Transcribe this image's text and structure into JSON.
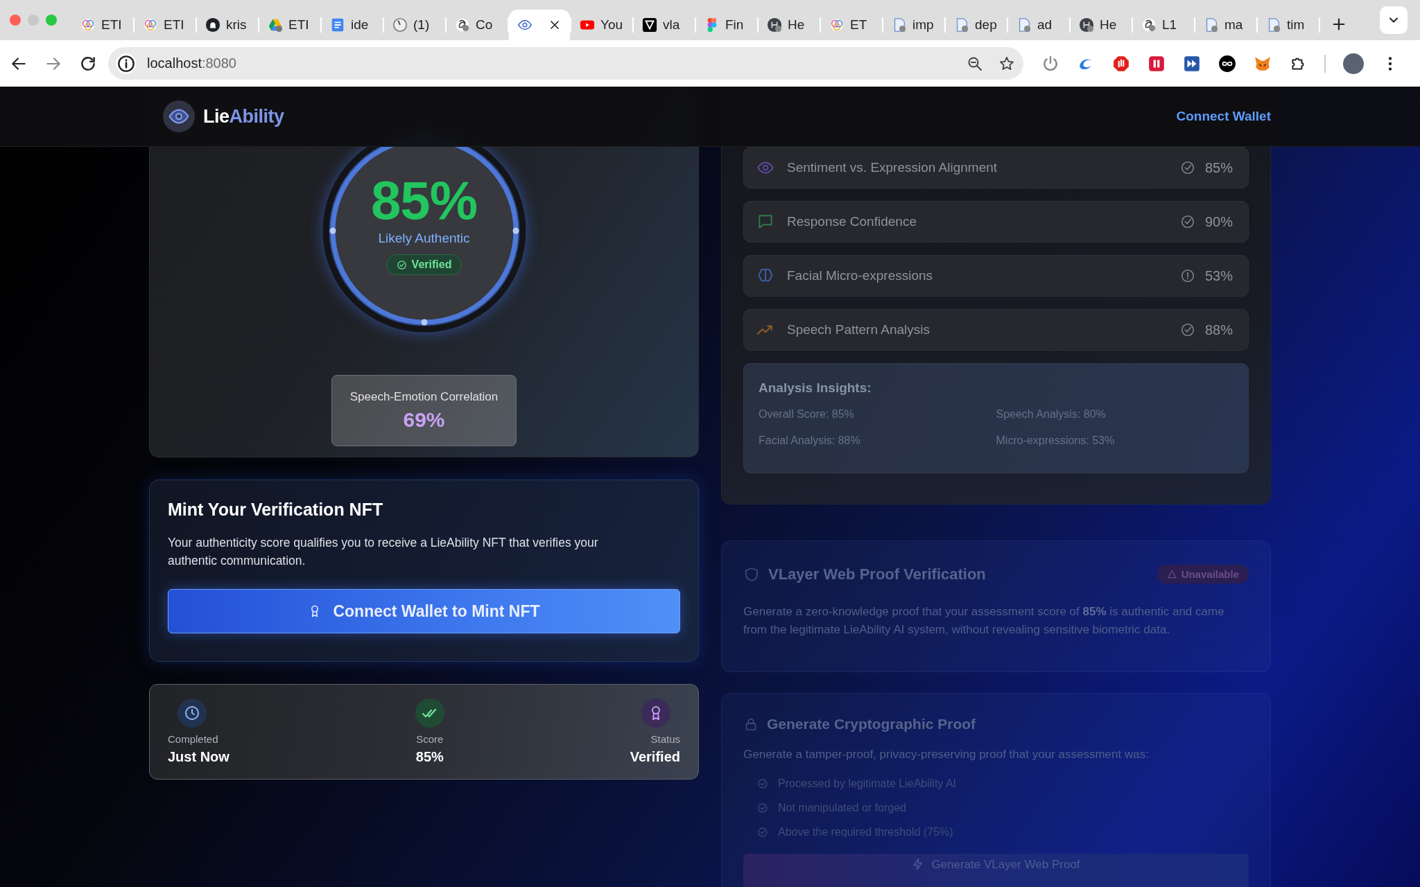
{
  "browser": {
    "tabs": [
      {
        "kind": "orb",
        "title": "ETI",
        "selected": false
      },
      {
        "kind": "orb",
        "title": "ETI",
        "selected": false
      },
      {
        "kind": "github",
        "title": "kris",
        "selected": false
      },
      {
        "kind": "drive",
        "title": "ETI",
        "selected": false
      },
      {
        "kind": "doc",
        "title": "ide",
        "selected": false
      },
      {
        "kind": "dial",
        "title": "(1)",
        "selected": false
      },
      {
        "kind": "knot",
        "title": "Co",
        "selected": false
      },
      {
        "kind": "eye",
        "selected": true
      },
      {
        "kind": "video",
        "title": "You",
        "selected": false
      },
      {
        "kind": "vee",
        "title": "vla",
        "selected": false
      },
      {
        "kind": "design",
        "title": "Fin",
        "selected": false
      },
      {
        "kind": "darkdisc",
        "title": "He",
        "selected": false
      },
      {
        "kind": "orb",
        "title": "ET",
        "selected": false
      },
      {
        "kind": "page",
        "title": "imp",
        "selected": false
      },
      {
        "kind": "page",
        "title": "dep",
        "selected": false
      },
      {
        "kind": "page",
        "title": "ad",
        "selected": false
      },
      {
        "kind": "darkdisc",
        "title": "He",
        "selected": false
      },
      {
        "kind": "knot",
        "title": "L1",
        "selected": false
      },
      {
        "kind": "page",
        "title": "ma",
        "selected": false
      },
      {
        "kind": "page",
        "title": "tim",
        "selected": false
      }
    ],
    "host": "localhost",
    "port": ":8080"
  },
  "header": {
    "logo_main": "Lie",
    "logo_accent": "Ability",
    "connect": "Connect Wallet"
  },
  "score": {
    "value": "85%",
    "verdict": "Likely Authentic",
    "badge": "Verified",
    "correlation_label": "Speech-Emotion Correlation",
    "correlation_value": "69%"
  },
  "mint": {
    "title": "Mint Your Verification NFT",
    "text": "Your authenticity score qualifies you to receive a LieAbility NFT that verifies your authentic communication.",
    "button": "Connect Wallet to Mint NFT"
  },
  "stats": [
    {
      "kind": "clock",
      "label": "Completed",
      "value": "Just Now"
    },
    {
      "kind": "check",
      "label": "Score",
      "value": "85%"
    },
    {
      "kind": "award",
      "label": "Status",
      "value": "Verified"
    }
  ],
  "breakdown": [
    {
      "kind": "eye",
      "name": "Sentiment vs. Expression Alignment",
      "flagged": false,
      "value": "85%"
    },
    {
      "kind": "chat",
      "name": "Response Confidence",
      "flagged": false,
      "value": "90%"
    },
    {
      "kind": "brain",
      "name": "Facial Micro-expressions",
      "flagged": true,
      "value": "53%"
    },
    {
      "kind": "trend",
      "name": "Speech Pattern Analysis",
      "flagged": false,
      "value": "88%"
    }
  ],
  "insights": {
    "title": "Analysis Insights:",
    "items": [
      "Overall Score: 85%",
      "Speech Analysis: 80%",
      "Facial Analysis: 88%",
      "Micro-expressions: 53%"
    ]
  },
  "vlayer": {
    "title": "VLayer Web Proof Verification",
    "badge": "Unavailable",
    "text": "Generate a zero-knowledge proof that your assessment score of **85%** is authentic and came from the legitimate LieAbility AI system, without revealing sensitive biometric data."
  },
  "crypto": {
    "title": "Generate Cryptographic Proof",
    "text": "Generate a tamper-proof, privacy-preserving proof that your assessment was:",
    "checks": [
      "Processed by legitimate LieAbility AI",
      "Not manipulated or forged",
      "Above the required threshold (75%)"
    ],
    "button": "Generate VLayer Web Proof"
  }
}
